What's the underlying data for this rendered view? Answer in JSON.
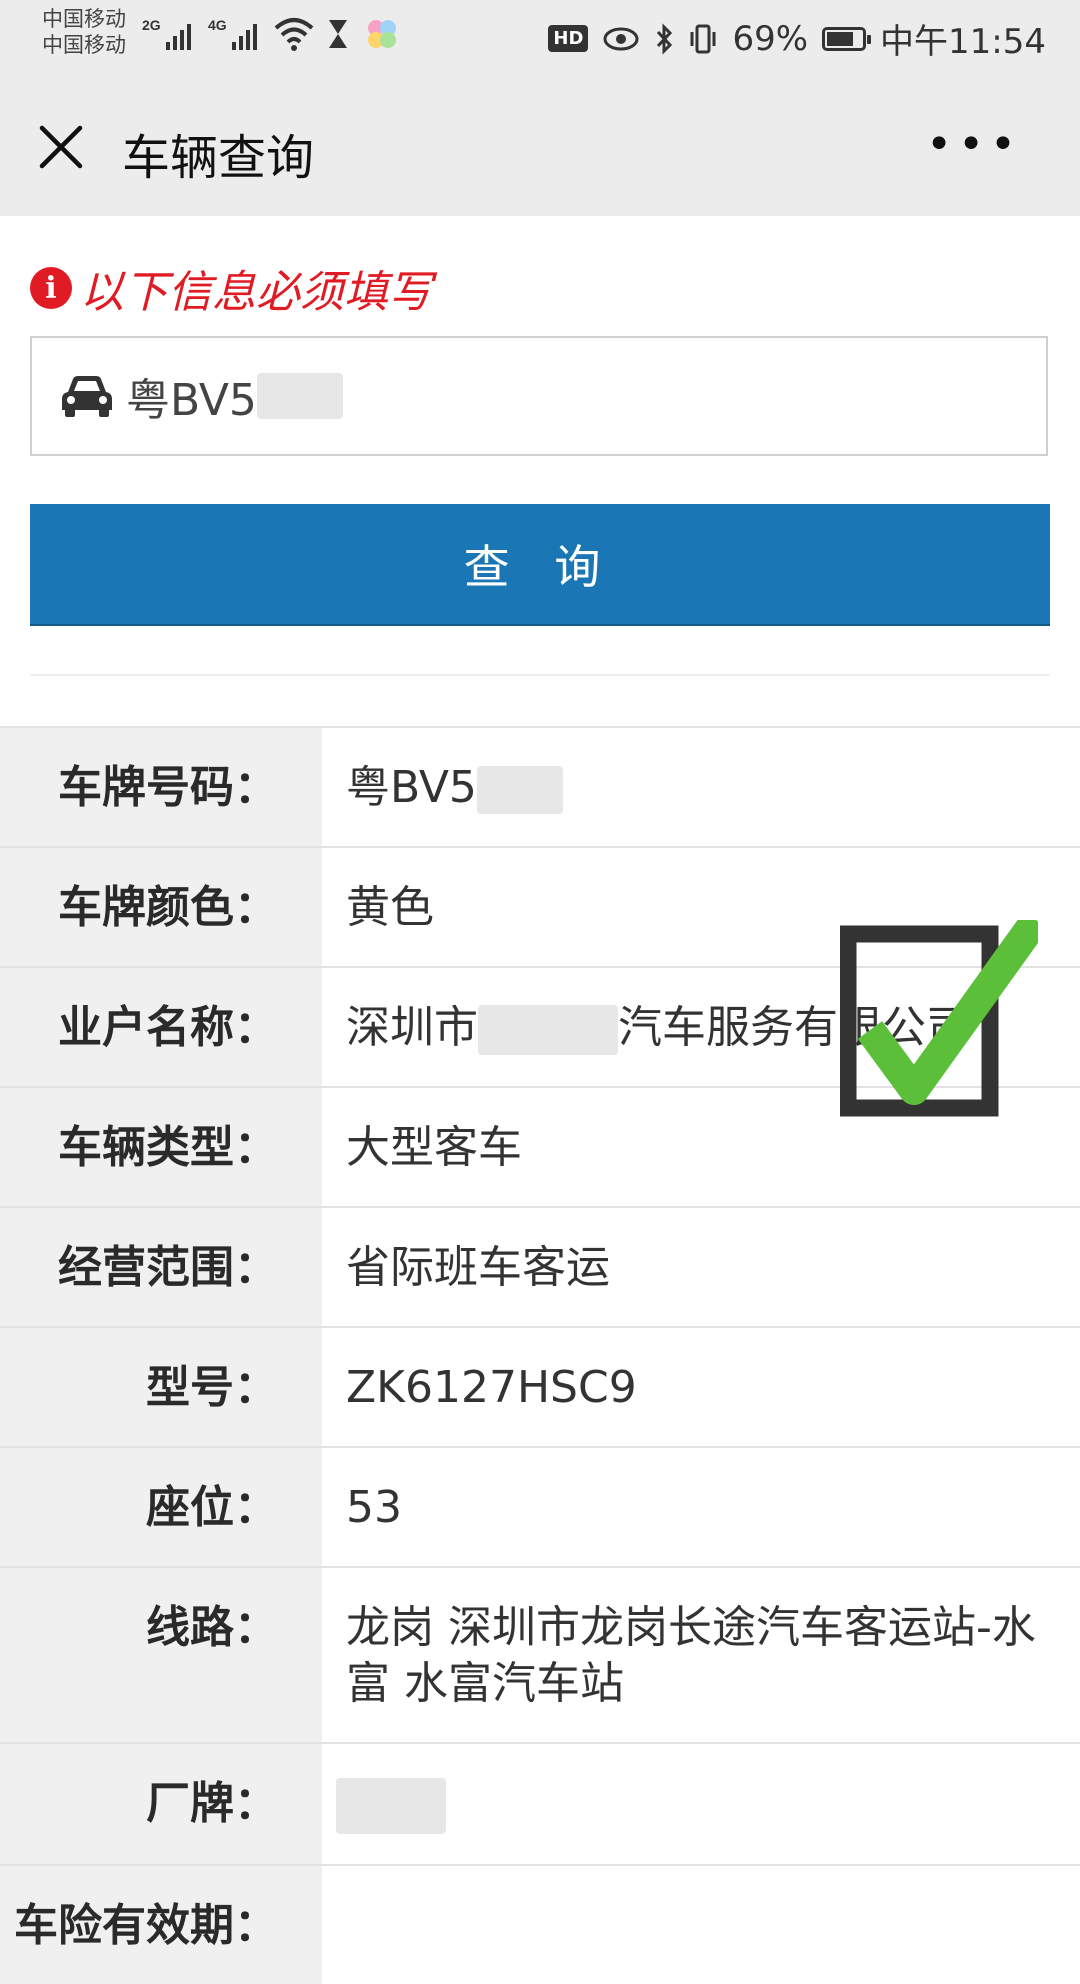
{
  "status_bar": {
    "carrier_1": "中国移动",
    "carrier_2": "中国移动",
    "net_1": "2G",
    "net_2": "4G",
    "hd": "HD",
    "battery": "69%",
    "time": "中午11:54"
  },
  "nav": {
    "title": "车辆查询",
    "more": "•••"
  },
  "form": {
    "required_notice": "以下信息必须填写",
    "plate_input_value": "粤BV5",
    "query_button": "查 询"
  },
  "result": {
    "rows": [
      {
        "label": "车牌号码：",
        "value": "粤BV5"
      },
      {
        "label": "车牌颜色：",
        "value": "黄色"
      },
      {
        "label": "业户名称：",
        "value_prefix": "深圳市",
        "value_suffix": "汽车服务有限公司"
      },
      {
        "label": "车辆类型：",
        "value": "大型客车"
      },
      {
        "label": "经营范围：",
        "value": "省际班车客运"
      },
      {
        "label": "型号：",
        "value": "ZK6127HSC9"
      },
      {
        "label": "座位：",
        "value": "53"
      },
      {
        "label": "线路：",
        "value": "龙岗 深圳市龙岗长途汽车客运站-水富 水富汽车站"
      },
      {
        "label": "厂牌：",
        "value": ""
      },
      {
        "label": "车险有效期：",
        "value": ""
      }
    ]
  },
  "colors": {
    "accent": "#1a76b4",
    "required": "#e01b24",
    "check_green": "#5cbf3a"
  },
  "icons": [
    "close-icon",
    "more-icon",
    "info-icon",
    "car-icon",
    "checkbox-check-icon"
  ]
}
